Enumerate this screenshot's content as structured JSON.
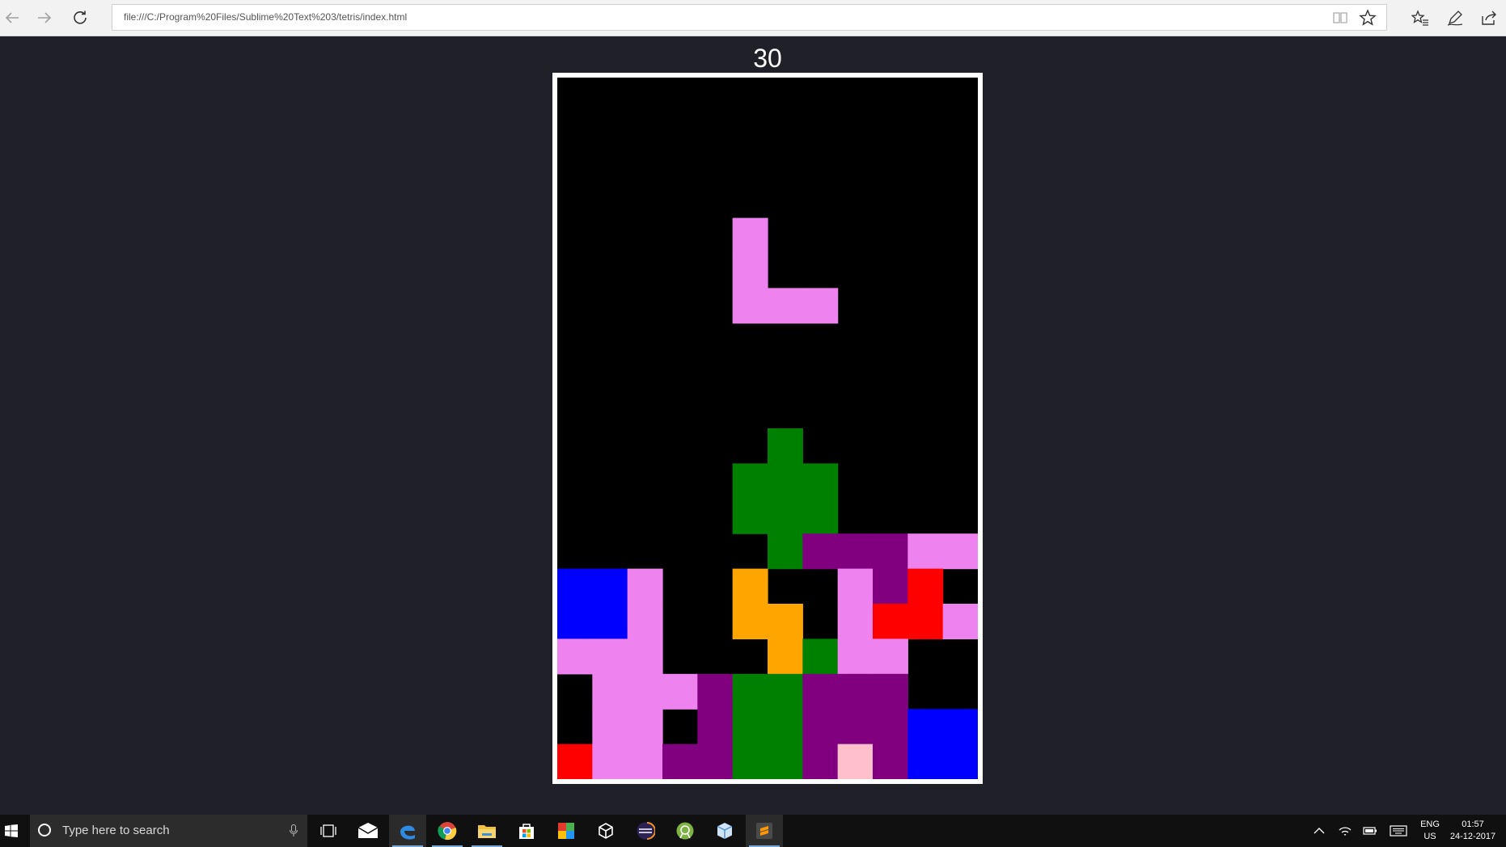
{
  "browser": {
    "url": "file:///C:/Program%20Files/Sublime%20Text%203/tetris/index.html",
    "icons": {
      "back": "back-arrow-icon",
      "forward": "forward-arrow-icon",
      "refresh": "refresh-icon",
      "reading_view": "reading-view-icon",
      "favorite": "star-icon",
      "favorites_hub": "favorites-list-icon",
      "notes": "pen-icon",
      "share": "share-icon"
    }
  },
  "game": {
    "score": "30",
    "grid": {
      "cols": 12,
      "rows": 20
    },
    "colors": {
      "V": "#ee82ee",
      "G": "#008000",
      "P": "#800080",
      "B": "#0000ff",
      "O": "#ffa500",
      "R": "#ff0000",
      "K": "#ffc0cb"
    },
    "falling_piece": {
      "color": "V",
      "cells": [
        [
          5,
          4
        ],
        [
          5,
          5
        ],
        [
          5,
          6
        ],
        [
          6,
          6
        ],
        [
          7,
          6
        ]
      ]
    },
    "board": [
      "............",
      "............",
      "............",
      "............",
      "............",
      "............",
      "............",
      "............",
      "............",
      "............",
      "......G.....",
      ".....GGG....",
      ".....GGG....",
      "......GPPPVV",
      "BBV..O..VPR.",
      "BBV..OO.VRRV",
      "VVV...OGVV..",
      ".VVVPGGPPP..",
      ".VV.PGGPPPBB",
      "RVVPPGGPKPBB"
    ]
  },
  "taskbar": {
    "search_placeholder": "Type here to search",
    "apps": [
      {
        "name": "task-view-icon"
      },
      {
        "name": "mail-icon"
      },
      {
        "name": "edge-icon",
        "active": true
      },
      {
        "name": "chrome-icon"
      },
      {
        "name": "file-explorer-icon"
      },
      {
        "name": "store-icon"
      },
      {
        "name": "tiles-app-icon"
      },
      {
        "name": "unity-icon"
      },
      {
        "name": "eclipse-icon"
      },
      {
        "name": "android-studio-icon"
      },
      {
        "name": "box-app-icon"
      },
      {
        "name": "sublime-text-icon"
      }
    ],
    "tray": {
      "language": "ENG",
      "region": "US",
      "time": "01:57",
      "date": "24-12-2017"
    }
  }
}
